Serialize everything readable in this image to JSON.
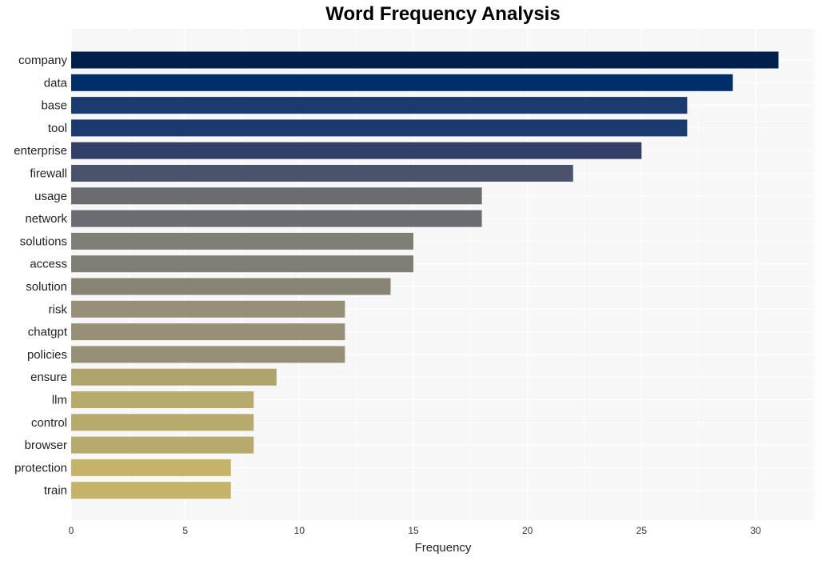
{
  "chart_data": {
    "type": "bar",
    "orientation": "horizontal",
    "title": "Word Frequency Analysis",
    "xlabel": "Frequency",
    "ylabel": "",
    "xlim": [
      0,
      32.6
    ],
    "xticks": [
      0,
      5,
      10,
      15,
      20,
      25,
      30
    ],
    "grid": true,
    "legend": "none",
    "categories": [
      "company",
      "data",
      "base",
      "tool",
      "enterprise",
      "firewall",
      "usage",
      "network",
      "solutions",
      "access",
      "solution",
      "risk",
      "chatgpt",
      "policies",
      "ensure",
      "llm",
      "control",
      "browser",
      "protection",
      "train"
    ],
    "values": [
      31,
      29,
      27,
      27,
      25,
      22,
      18,
      18,
      15,
      15,
      14,
      12,
      12,
      12,
      9,
      8,
      8,
      8,
      7,
      7
    ],
    "colors": [
      "#00204c",
      "#002e6a",
      "#1b3a6e",
      "#1b3a6e",
      "#323f66",
      "#4b526b",
      "#6b6c71",
      "#6b6c71",
      "#7f7e76",
      "#7f7e76",
      "#878375",
      "#989076",
      "#989076",
      "#989076",
      "#b0a46e",
      "#b6aa6d",
      "#b6aa6d",
      "#b6aa6d",
      "#c4b369",
      "#c4b369"
    ]
  }
}
